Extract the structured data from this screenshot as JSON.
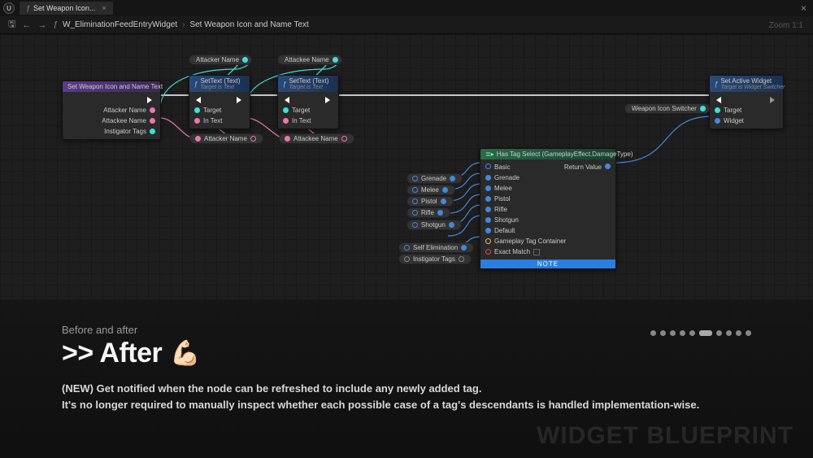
{
  "tab_title": "Set Weapon Icon...",
  "breadcrumb": {
    "widget": "W_EliminationFeedEntryWidget",
    "func": "Set Weapon Icon and Name Text"
  },
  "zoom": "Zoom 1:1",
  "nodes": {
    "entry": {
      "title": "Set Weapon Icon and Name Text",
      "p1": "Attacker Name",
      "p2": "Attackee Name",
      "p3": "Instigator Tags"
    },
    "settext1": {
      "title": "SetText (Text)",
      "sub": "Target is Text",
      "target": "Target",
      "intext": "In Text"
    },
    "settext2": {
      "title": "SetText (Text)",
      "sub": "Target is Text",
      "target": "Target",
      "intext": "In Text"
    },
    "active": {
      "title": "Set Active Widget",
      "sub": "Target is Widget Switcher",
      "target": "Target",
      "widget": "Widget"
    },
    "hastagtitle": "Has Tag Select (GameplayEffect.DamageType)",
    "tags": [
      "Basic",
      "Grenade",
      "Melee",
      "Pistol",
      "Rifle",
      "Shotgun",
      "Default",
      "Gameplay Tag Container"
    ],
    "exact": "Exact Match",
    "returnval": "Return Value",
    "notelabel": "NOTE"
  },
  "pills": {
    "attacker_top": "Attacker Name",
    "attackee_top": "Attackee Name",
    "attacker_bot": "Attacker Name",
    "attackee_bot": "Attackee Name",
    "switcher": "Weapon Icon Switcher",
    "inputs": [
      "Grenade",
      "Melee",
      "Pistol",
      "Rifle",
      "Shotgun",
      "Self Elimination",
      "Instigator Tags"
    ]
  },
  "overlay": {
    "small": "Before and after",
    "big": ">> After",
    "emoji": "💪🏻",
    "l1": "(NEW) Get notified when the node can be refreshed to include any newly added tag.",
    "l2": "It's no longer required to manually inspect whether each possible case of a tag's descendants is handled implementation-wise."
  },
  "watermark": "WIDGET BLUEPRINT"
}
